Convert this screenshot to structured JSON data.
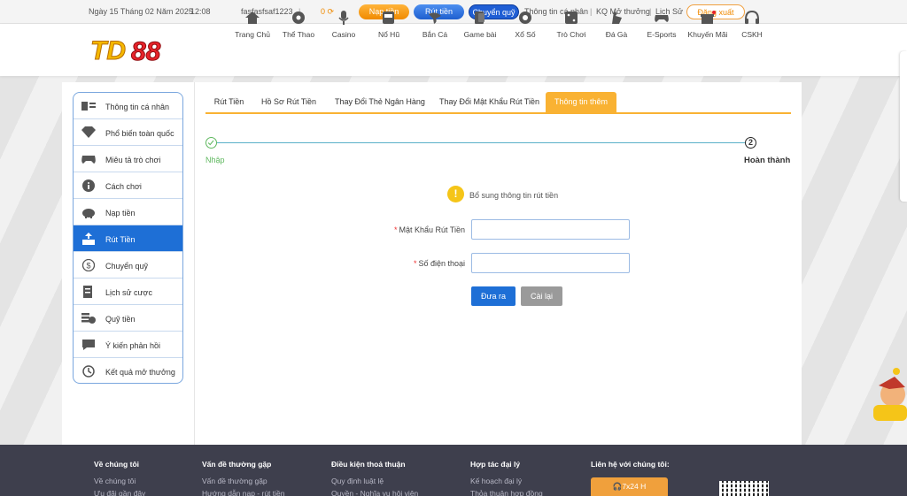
{
  "topbar": {
    "date": "Ngày 15 Tháng 02 Năm 2025",
    "time": "12:08",
    "username": "fasfasfsaf1223",
    "balance": "0",
    "deposit_label": "Nạp tiền",
    "withdraw_label": "Rút tiền",
    "transfer_label": "Chuyển quỹ",
    "profile_link": "Thông tin cá nhân",
    "results_link": "KQ Mở thưởng",
    "history_link": "Lịch Sử",
    "logout_label": "Đăng xuất"
  },
  "logo": {
    "text": "TD88"
  },
  "nav": [
    {
      "label": "Trang Chủ",
      "icon": "home-icon"
    },
    {
      "label": "Thể Thao",
      "icon": "soccer-ball-icon"
    },
    {
      "label": "Casino",
      "icon": "microphone-icon"
    },
    {
      "label": "Nổ Hũ",
      "icon": "slot-machine-icon"
    },
    {
      "label": "Bắn Cá",
      "icon": "fish-icon"
    },
    {
      "label": "Game bài",
      "icon": "cards-icon"
    },
    {
      "label": "Xổ Số",
      "icon": "lottery-ball-icon"
    },
    {
      "label": "Trò Chơi",
      "icon": "dice-icon"
    },
    {
      "label": "Đá Gà",
      "icon": "rooster-icon"
    },
    {
      "label": "E-Sports",
      "icon": "gamepad-icon"
    },
    {
      "label": "Khuyến Mãi",
      "icon": "gift-icon"
    },
    {
      "label": "CSKH",
      "icon": "headset-icon"
    }
  ],
  "sidebar": {
    "items": [
      {
        "label": "Thông tin cá nhân",
        "icon": "id-card-icon",
        "active": false
      },
      {
        "label": "Phổ biến toàn quốc",
        "icon": "diamond-icon",
        "active": false
      },
      {
        "label": "Miêu tả trò chơi",
        "icon": "gamepad-icon",
        "active": false
      },
      {
        "label": "Cách chơi",
        "icon": "info-icon",
        "active": false
      },
      {
        "label": "Nạp tiền",
        "icon": "piggy-bank-icon",
        "active": false
      },
      {
        "label": "Rút Tiền",
        "icon": "withdraw-icon",
        "active": true
      },
      {
        "label": "Chuyển quỹ",
        "icon": "dollar-coin-icon",
        "active": false
      },
      {
        "label": "Lịch sử cược",
        "icon": "receipt-icon",
        "active": false
      },
      {
        "label": "Quỹ tiền",
        "icon": "money-stack-icon",
        "active": false
      },
      {
        "label": "Ý kiến phản hồi",
        "icon": "chat-bubble-icon",
        "active": false
      },
      {
        "label": "Kết quả mở thưởng",
        "icon": "history-clock-icon",
        "active": false
      }
    ]
  },
  "tabs": [
    {
      "label": "Rút Tiền",
      "active": false
    },
    {
      "label": "Hồ Sơ Rút Tiền",
      "active": false
    },
    {
      "label": "Thay Đổi Thẻ Ngân Hàng",
      "active": false
    },
    {
      "label": "Thay Đổi Mật Khẩu Rút Tiền",
      "active": false
    },
    {
      "label": "Thông tin thêm",
      "active": true
    }
  ],
  "steps": {
    "step1_label": "Nhập",
    "step2_number": "2",
    "step2_label": "Hoàn thành"
  },
  "notice": "Bổ sung thông tin rút tiền",
  "form": {
    "password_label": "Mật Khẩu Rút Tiền",
    "password_value": "",
    "phone_label": "Số điện thoại",
    "phone_value": "",
    "required_mark": "*",
    "submit_label": "Đưa ra",
    "reset_label": "Cài lại"
  },
  "footer": {
    "col1": {
      "title": "Về chúng tôi",
      "links": [
        "Về chúng tôi",
        "Ưu đãi gần đây"
      ]
    },
    "col2": {
      "title": "Vấn đề thường gặp",
      "links": [
        "Vấn đề thường gặp",
        "Hướng dẫn nạp - rút tiền"
      ]
    },
    "col3": {
      "title": "Điều kiện thoả thuận",
      "links": [
        "Quy định luật lệ",
        "Quyền - Nghĩa vụ hội viên"
      ]
    },
    "col4": {
      "title": "Hợp tác đại lý",
      "links": [
        "Kế hoạch đại lý",
        "Thỏa thuận hợp đồng"
      ]
    },
    "col5": {
      "title": "Liên hệ với chúng tôi:",
      "hotline": "7x24 H"
    }
  },
  "colors": {
    "accent_blue": "#1e6fd6",
    "accent_orange": "#f9b233",
    "success_green": "#5fb85f",
    "footer_bg": "#3e3f4d"
  }
}
